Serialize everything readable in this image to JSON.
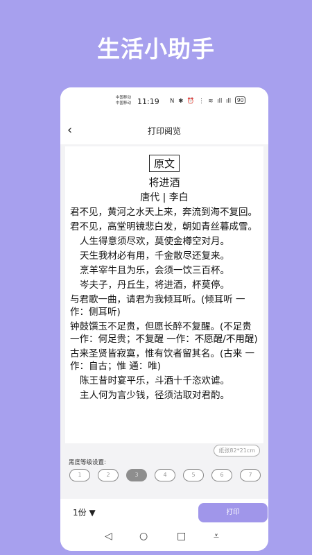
{
  "banner": {
    "title": "生活小助手"
  },
  "statusbar": {
    "carrier1": "中国移动",
    "carrier2": "中国移动",
    "time": "11:19",
    "icons": [
      "N",
      "✱",
      "⏰",
      "⋮",
      "≋",
      "ıll",
      "ıll"
    ],
    "battery": "90"
  },
  "nav": {
    "back": "‹",
    "title": "打印阅览"
  },
  "poem": {
    "label": "原文",
    "title": "将进酒",
    "author": "唐代 | 李白",
    "lines": [
      {
        "text": "君不见，黄河之水天上来，奔流到海不复回。",
        "indent": false
      },
      {
        "text": "君不见，高堂明镜悲白发，朝如青丝暮成雪。",
        "indent": false
      },
      {
        "text": "人生得意须尽欢，莫使金樽空对月。",
        "indent": true
      },
      {
        "text": "天生我材必有用，千金散尽还复来。",
        "indent": true
      },
      {
        "text": "烹羊宰牛且为乐，会须一饮三百杯。",
        "indent": true
      },
      {
        "text": "岑夫子，丹丘生，将进酒，杯莫停。",
        "indent": true
      },
      {
        "text": "与君歌一曲，请君为我倾耳听。(倾耳听 一作：侧耳听)",
        "indent": false
      },
      {
        "text": "钟鼓馔玉不足贵，但愿长醉不复醒。(不足贵 一作：何足贵；不复醒 一作：不愿醒/不用醒)",
        "indent": false
      },
      {
        "text": "古来圣贤皆寂寞，惟有饮者留其名。(古来 一作：自古；惟 通：唯)",
        "indent": false
      },
      {
        "text": "陈王昔时宴平乐，斗酒十千恣欢谑。",
        "indent": true
      },
      {
        "text": "主人何为言少钱，径须沽取对君酌。",
        "indent": true
      }
    ]
  },
  "settings": {
    "paper_size": "纸张82*21cm",
    "darkness_label": "黑度等级设置:",
    "levels": [
      "1",
      "2",
      "3",
      "4",
      "5",
      "6",
      "7"
    ],
    "active_level": "3"
  },
  "bottom": {
    "copies": "1份 ▼",
    "print": "打印"
  },
  "sysnav": {
    "back": "◁",
    "home": "○",
    "recent": "□",
    "menu": "⩡"
  }
}
